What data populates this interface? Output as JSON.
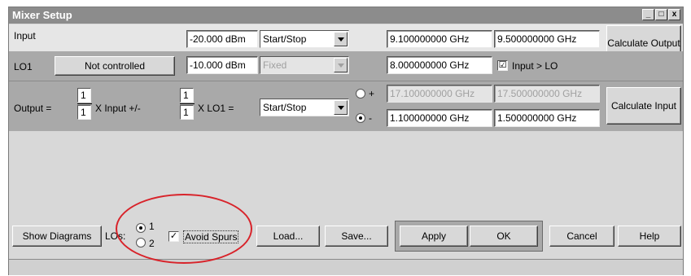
{
  "window": {
    "title": "Mixer Setup",
    "controls": [
      "_",
      "□",
      "x"
    ]
  },
  "input_row": {
    "label": "Input",
    "power": "-20.000 dBm",
    "mode": "Start/Stop",
    "start": "9.100000000 GHz",
    "stop": "9.500000000 GHz",
    "calc_button": "Calculate Output"
  },
  "lo1_row": {
    "label": "LO1",
    "control_button": "Not controlled",
    "power": "-10.000 dBm",
    "mode": "Fixed",
    "freq": "8.000000000 GHz",
    "input_gt_lo_label": "Input > LO",
    "input_gt_lo_checked": "☑"
  },
  "output_row": {
    "label_output": "Output =",
    "input_num": "1",
    "input_den": "1",
    "label_x_input": "X Input +/-",
    "lo_num": "1",
    "lo_den": "1",
    "label_x_lo1": "X LO1 =",
    "mode": "Start/Stop",
    "plus_sign": "+",
    "minus_sign": "-",
    "plus_start": "17.100000000 GHz",
    "plus_stop": "17.500000000 GHz",
    "minus_start": "1.100000000 GHz",
    "minus_stop": "1.500000000 GHz",
    "calc_button": "Calculate Input"
  },
  "bottom": {
    "show_diagrams": "Show Diagrams",
    "lo_label": "LOs:",
    "lo_option_1": "1",
    "lo_option_2": "2",
    "avoid_spurs": "Avoid Spurs",
    "load": "Load...",
    "save": "Save...",
    "apply": "Apply",
    "ok": "OK",
    "cancel": "Cancel",
    "help": "Help"
  },
  "colors": {
    "annotation_circle": "#d8232a",
    "section_gray": "#a9a9a9"
  }
}
